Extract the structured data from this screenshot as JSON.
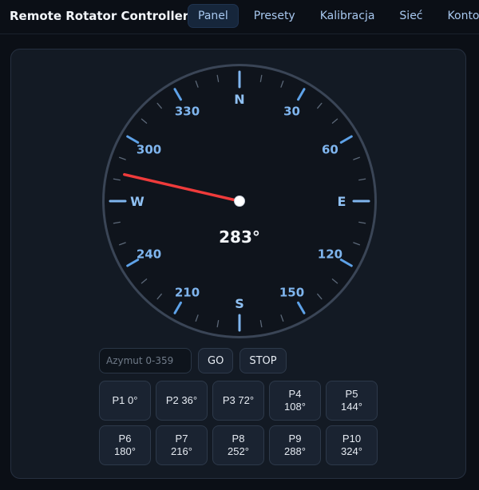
{
  "app": {
    "title": "Remote Rotator Controller"
  },
  "nav": [
    {
      "label": "Panel",
      "active": true
    },
    {
      "label": "Presety",
      "active": false
    },
    {
      "label": "Kalibracja",
      "active": false
    },
    {
      "label": "Sieć",
      "active": false
    },
    {
      "label": "Konto",
      "active": false
    }
  ],
  "dial": {
    "azimuth": 283,
    "readout": "283°",
    "cardinals": [
      {
        "label": "N",
        "angle": 0
      },
      {
        "label": "E",
        "angle": 90
      },
      {
        "label": "S",
        "angle": 180
      },
      {
        "label": "W",
        "angle": 270
      }
    ],
    "degree_labels": [
      {
        "label": "30",
        "angle": 30
      },
      {
        "label": "60",
        "angle": 60
      },
      {
        "label": "120",
        "angle": 120
      },
      {
        "label": "150",
        "angle": 150
      },
      {
        "label": "210",
        "angle": 210
      },
      {
        "label": "240",
        "angle": 240
      },
      {
        "label": "300",
        "angle": 300
      },
      {
        "label": "330",
        "angle": 330
      }
    ],
    "colors": {
      "needle": "#ef3b3b",
      "ticks": "#5ea2e8",
      "face": "#0f141c",
      "rim": "#3a4556"
    }
  },
  "controls": {
    "input_placeholder": "Azymut 0-359",
    "go_label": "GO",
    "stop_label": "STOP"
  },
  "presets": [
    {
      "name": "P1",
      "deg": "0°"
    },
    {
      "name": "P2",
      "deg": "36°"
    },
    {
      "name": "P3",
      "deg": "72°"
    },
    {
      "name": "P4",
      "deg": "108°"
    },
    {
      "name": "P5",
      "deg": "144°"
    },
    {
      "name": "P6",
      "deg": "180°"
    },
    {
      "name": "P7",
      "deg": "216°"
    },
    {
      "name": "P8",
      "deg": "252°"
    },
    {
      "name": "P9",
      "deg": "288°"
    },
    {
      "name": "P10",
      "deg": "324°"
    }
  ]
}
